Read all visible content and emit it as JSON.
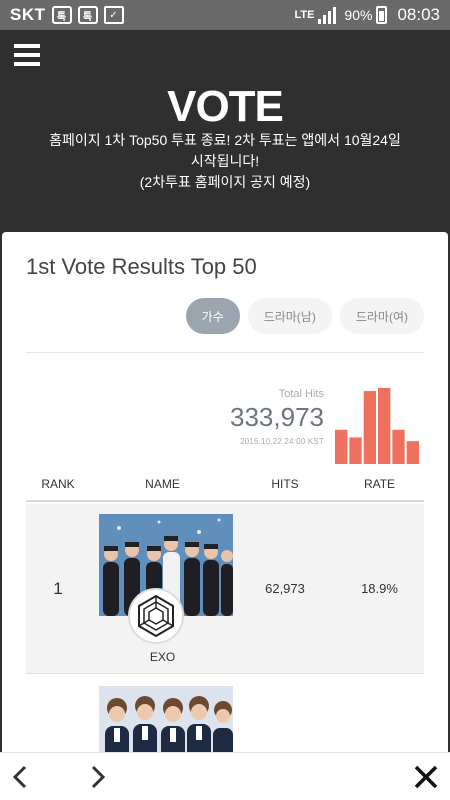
{
  "status_bar": {
    "carrier": "SKT",
    "notification_icons": [
      "talk-icon",
      "talk-icon",
      "briefcase-icon"
    ],
    "network": "LTE",
    "battery": "90%",
    "time": "08:03"
  },
  "header": {
    "logo": "VOTE",
    "notice_line1": "홈페이지 1차 Top50 투표 종료! 2차 투표는 앱에서 10월24일",
    "notice_line2": "시작됩니다!",
    "notice_line3": "(2차투표 홈페이지 공지 예정)"
  },
  "card": {
    "title": "1st Vote Results Top 50",
    "tabs": [
      {
        "label": "가수",
        "active": true
      },
      {
        "label": "드라마(남)",
        "active": false
      },
      {
        "label": "드라마(여)",
        "active": false
      }
    ],
    "total_hits_label": "Total Hits",
    "total_hits_value": "333,973",
    "timestamp": "2016.10.22 24:00 KST",
    "bar_heights": [
      0.45,
      0.35,
      0.96,
      1.0,
      0.45,
      0.3
    ],
    "bar_color": "#f07060"
  },
  "table": {
    "headers": {
      "rank": "RANK",
      "name": "NAME",
      "hits": "HITS",
      "rate": "RATE"
    },
    "rows": [
      {
        "rank": "1",
        "name": "EXO",
        "hits": "62,973",
        "rate": "18.9%"
      },
      {
        "rank": "",
        "name": "",
        "hits": "",
        "rate": ""
      }
    ]
  },
  "nav": {
    "back": "chevron-left-icon",
    "forward": "chevron-right-icon",
    "close": "close-icon"
  }
}
